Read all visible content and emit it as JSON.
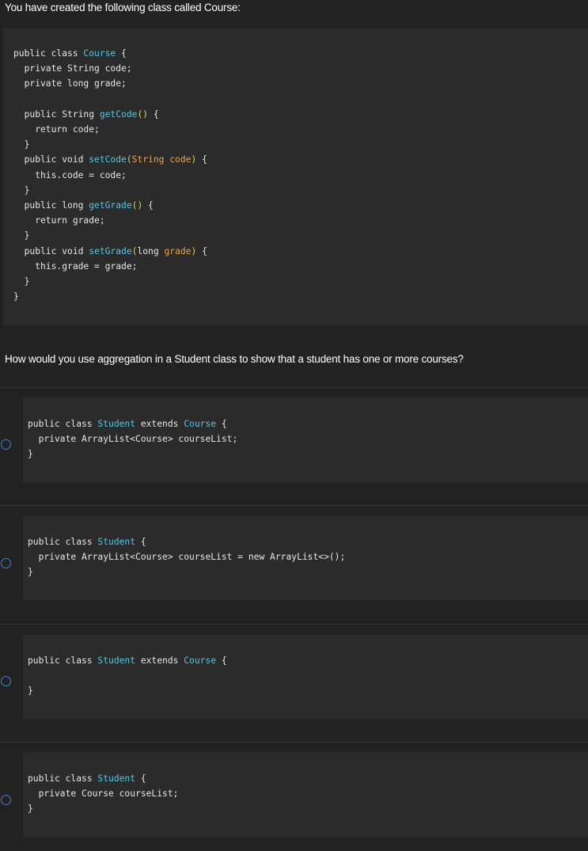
{
  "intro": "You have created the following class called Course:",
  "question": "How would you use aggregation in a Student class to show that a student has one or more courses?",
  "course_code": {
    "l1_kw": "public class ",
    "l1_cls": "Course",
    "l1_end": " {",
    "l2": "  private String code;",
    "l3": "  private long grade;",
    "l5_kw": "  public String ",
    "l5_fn": "getCode",
    "l5_p": "()",
    "l5_end": " {",
    "l6": "    return code;",
    "l7": "  }",
    "l8_kw": "  public void ",
    "l8_fn": "setCode",
    "l8_p1": "(",
    "l8_par": "String code",
    "l8_p2": ")",
    "l8_end": " {",
    "l9": "    this.code = code;",
    "l10": "  }",
    "l11_kw": "  public long ",
    "l11_fn": "getGrade",
    "l11_p": "()",
    "l11_end": " {",
    "l12": "    return grade;",
    "l13": "  }",
    "l14_kw": "  public void ",
    "l14_fn": "setGrade",
    "l14_p1": "(",
    "l14_par_kw": "long ",
    "l14_par": "grade",
    "l14_p2": ")",
    "l14_end": " {",
    "l15": "    this.grade = grade;",
    "l16": "  }",
    "l17": "}"
  },
  "options": [
    {
      "l1_kw": "public class ",
      "l1_cls": "Student",
      "l1_mid": " extends ",
      "l1_cls2": "Course",
      "l1_end": " {",
      "l2": "  private ArrayList<Course> courseList;",
      "l3": "}"
    },
    {
      "l1_kw": "public class ",
      "l1_cls": "Student",
      "l1_end": " {",
      "l2": "  private ArrayList<Course> courseList = new ArrayList<>();",
      "l3": "}"
    },
    {
      "l1_kw": "public class ",
      "l1_cls": "Student",
      "l1_mid": " extends ",
      "l1_cls2": "Course",
      "l1_end": " {",
      "l2": "",
      "l3": "}"
    },
    {
      "l1_kw": "public class ",
      "l1_cls": "Student",
      "l1_end": " {",
      "l2": "  private Course courseList;",
      "l3": "}"
    }
  ]
}
